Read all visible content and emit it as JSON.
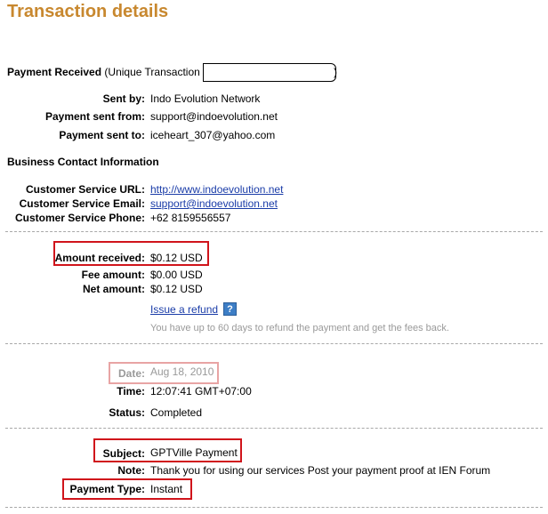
{
  "page": {
    "title": "Transaction details"
  },
  "header": {
    "label": "Payment Received",
    "suffix_open": "(Unique Transaction",
    "suffix_close": ")"
  },
  "details": {
    "sent_by": {
      "label": "Sent by:",
      "value": "Indo Evolution Network"
    },
    "sent_from": {
      "label": "Payment sent from:",
      "value": "support@indoevolution.net"
    },
    "sent_to": {
      "label": "Payment sent to:",
      "value": "iceheart_307@yahoo.com"
    }
  },
  "business": {
    "heading": "Business Contact Information",
    "url": {
      "label": "Customer Service URL:",
      "value": "http://www.indoevolution.net"
    },
    "email": {
      "label": "Customer Service Email:",
      "value": "support@indoevolution.net"
    },
    "phone": {
      "label": "Customer Service Phone:",
      "value": "+62 8159556557"
    }
  },
  "amounts": {
    "received": {
      "label": "Amount received:",
      "value": "$0.12 USD"
    },
    "fee": {
      "label": "Fee amount:",
      "value": "$0.00 USD"
    },
    "net": {
      "label": "Net amount:",
      "value": "$0.12 USD"
    },
    "refund_link": "Issue a refund",
    "help_icon": "?",
    "refund_note": "You have up to 60 days to refund the payment and get the fees back."
  },
  "timing": {
    "date": {
      "label": "Date:",
      "value": "Aug 18, 2010"
    },
    "time": {
      "label": "Time:",
      "value": "12:07:41 GMT+07:00"
    },
    "status": {
      "label": "Status:",
      "value": "Completed"
    }
  },
  "message": {
    "subject": {
      "label": "Subject:",
      "value": "GPTVille Payment"
    },
    "note": {
      "label": "Note:",
      "value": "Thank you for using our services Post your payment proof at IEN Forum"
    },
    "payment_type": {
      "label": "Payment Type:",
      "value": "Instant"
    }
  },
  "colors": {
    "title": "#c8882f",
    "link": "#1a3ca8",
    "highlight_red": "#d0141b",
    "highlight_pink": "#e8a4a4",
    "muted": "#999999"
  }
}
